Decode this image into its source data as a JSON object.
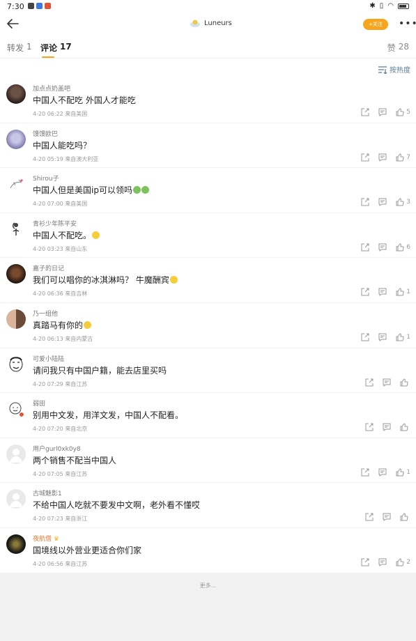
{
  "status_bar": {
    "time": "7:30"
  },
  "nav": {
    "title": "Luneurs",
    "follow": "+关注"
  },
  "tabs": [
    {
      "label": "转发",
      "count": "1"
    },
    {
      "label": "评论",
      "count": "17"
    }
  ],
  "likes_tab": {
    "label": "赞",
    "count": "28"
  },
  "sort": {
    "label": "按热度"
  },
  "comments": [
    {
      "user": "加点点奶盖吧",
      "text": "中国人不配吃 外国人才能吃",
      "meta": "4-20 06:22  来自美国",
      "likes": "5"
    },
    {
      "user": "馒馒欧巴",
      "text": "中国人能吃吗？",
      "meta": "4-20 05:19  来自澳大利亚",
      "likes": "7"
    },
    {
      "user": "Shirou子",
      "text": "中国人但是美国ip可以领吗",
      "meta": "4-20 07:00  来自美国",
      "likes": "3"
    },
    {
      "user": "青衫少年陈平安",
      "text": "中国人不配吃。",
      "meta": "4-20 03:23  来自山东",
      "likes": "6"
    },
    {
      "user": "嘉子的日记",
      "text": "我们可以唱你的冰淇淋吗？ 牛魔酬宾",
      "meta": "4-20 06:36  来自吉林",
      "likes": "1"
    },
    {
      "user": "乃一组他",
      "text": "真踏马有你的",
      "meta": "4-20 06:13  来自内蒙古",
      "likes": "1"
    },
    {
      "user": "可爱小陆陆",
      "text": "请问我只有中国户籍，能去店里买吗",
      "meta": "4-20 07:29  来自江苏",
      "likes": ""
    },
    {
      "user": "弱田",
      "text": "别用中文发，用洋文发，中国人不配看。",
      "meta": "4-20 07:20  来自北京",
      "likes": ""
    },
    {
      "user": "用户gurl0xk0y8",
      "text": "两个销售不配当中国人",
      "meta": "4-20 07:05  来自江苏",
      "likes": "1"
    },
    {
      "user": "古城魅影1",
      "text": "不给中国人吃就不要发中文啊，老外看不懂哎",
      "meta": "4-20 07:23  来自浙江",
      "likes": ""
    },
    {
      "user": "夜航僧",
      "text": "国境线以外营业更适合你们家",
      "meta": "4-20 06:56  来自江苏",
      "likes": "2"
    }
  ],
  "footer": {
    "more": "更多..."
  },
  "colors": {
    "accent": "#f7a51d",
    "sort_link": "#5a7a99"
  }
}
